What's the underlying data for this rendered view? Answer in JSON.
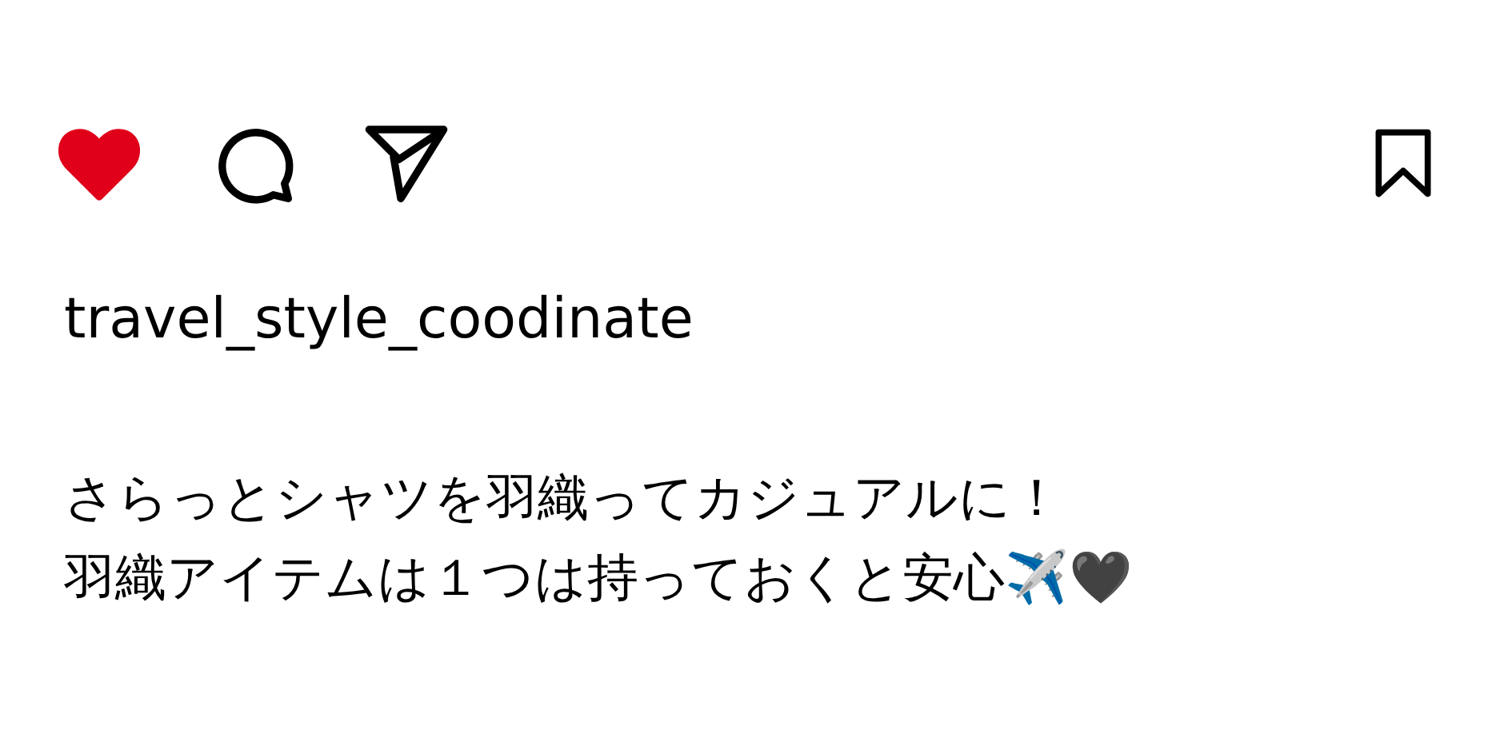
{
  "actions": {
    "liked": true,
    "saved": false
  },
  "username": "travel_style_coodinate",
  "caption": [
    "さらっとシャツを羽織ってカジュアルに！",
    "羽織アイテムは１つは持っておくと安心✈️🖤"
  ]
}
